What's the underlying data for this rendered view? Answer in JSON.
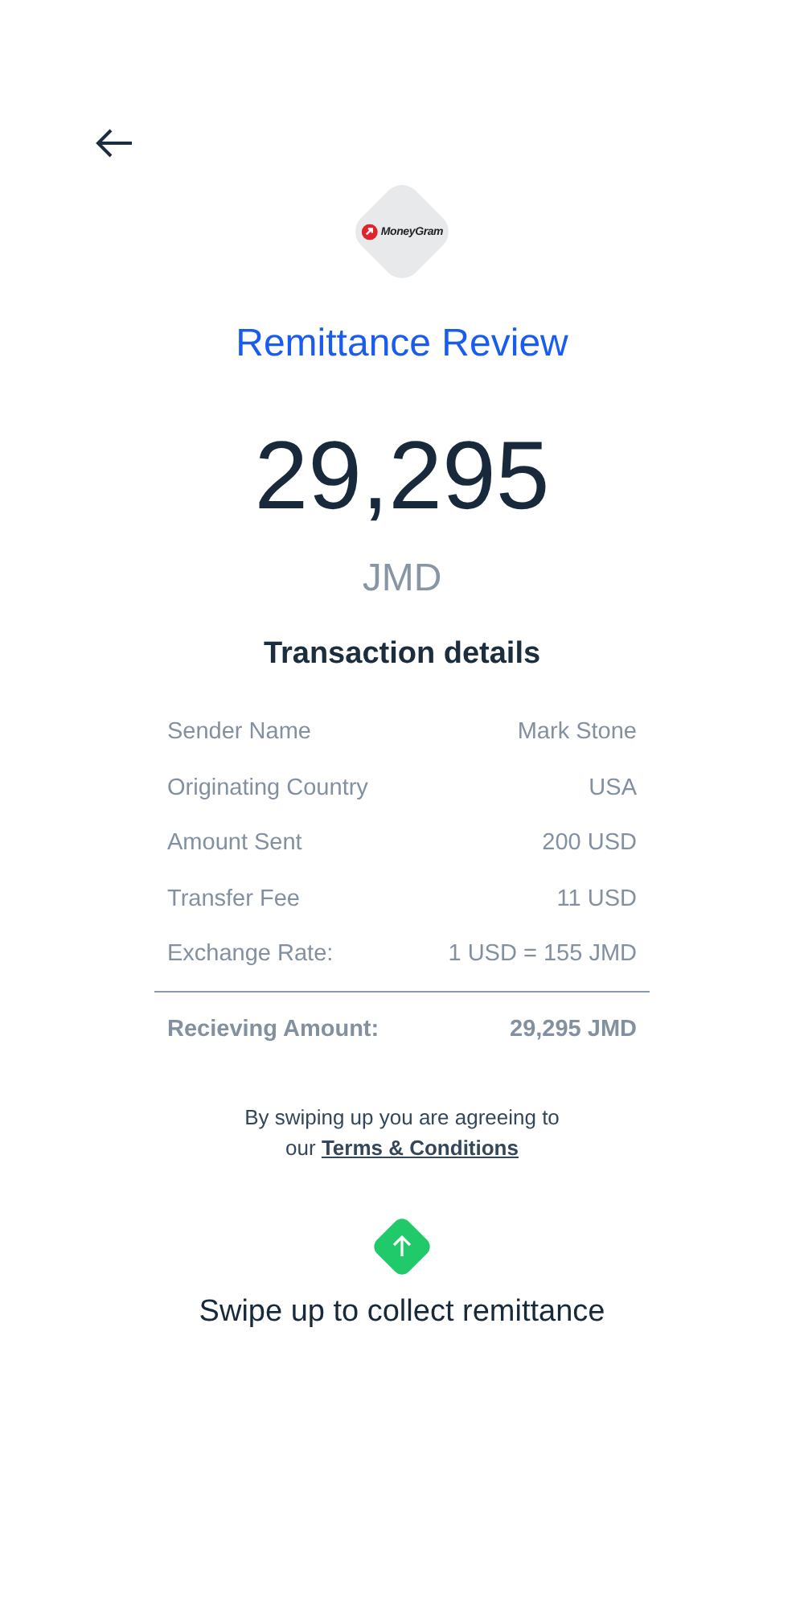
{
  "header": {
    "logo_text": "MoneyGram",
    "title": "Remittance Review"
  },
  "amount": {
    "value": "29,295",
    "currency": "JMD"
  },
  "details": {
    "heading": "Transaction details",
    "rows": [
      {
        "label": "Sender Name",
        "value": "Mark Stone",
        "kind": "plain"
      },
      {
        "label": "Originating Country",
        "value": "USA",
        "kind": "plain"
      },
      {
        "label": "Amount Sent",
        "value": "200 USD",
        "kind": "plain"
      },
      {
        "label": "Transfer Fee",
        "value": "11 USD",
        "kind": "plain"
      },
      {
        "label": "Exchange Rate:",
        "value": "1 USD = 155 JMD",
        "kind": "plain"
      },
      {
        "label": "Recieving Amount:",
        "value": "29,295 JMD",
        "kind": "total"
      }
    ]
  },
  "agreement": {
    "text": "By swiping up you are agreeing to our",
    "link": "Terms & Conditions"
  },
  "swipe": {
    "label": "Swipe up to collect remittance"
  }
}
